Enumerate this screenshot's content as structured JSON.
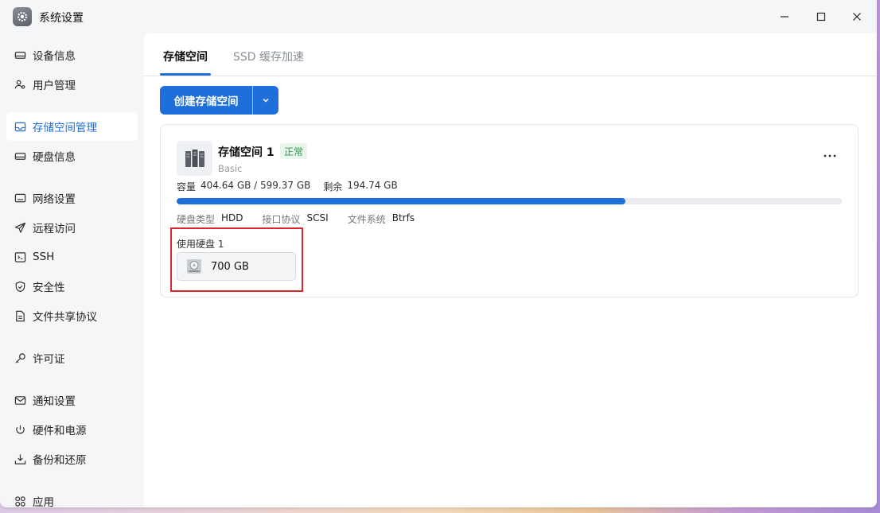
{
  "window": {
    "title": "系统设置"
  },
  "sidebar": {
    "items": [
      {
        "label": "设备信息",
        "icon": "hard-drive-icon"
      },
      {
        "label": "用户管理",
        "icon": "users-icon"
      },
      {
        "label": "存储空间管理",
        "icon": "inbox-icon",
        "active": true
      },
      {
        "label": "硬盘信息",
        "icon": "disk-icon"
      },
      {
        "label": "网络设置",
        "icon": "monitor-icon"
      },
      {
        "label": "远程访问",
        "icon": "send-icon"
      },
      {
        "label": "SSH",
        "icon": "terminal-icon"
      },
      {
        "label": "安全性",
        "icon": "shield-icon"
      },
      {
        "label": "文件共享协议",
        "icon": "file-icon"
      },
      {
        "label": "许可证",
        "icon": "key-icon"
      },
      {
        "label": "通知设置",
        "icon": "mail-icon"
      },
      {
        "label": "硬件和电源",
        "icon": "power-icon"
      },
      {
        "label": "备份和还原",
        "icon": "backup-icon"
      },
      {
        "label": "应用",
        "icon": "apps-icon"
      }
    ]
  },
  "tabs": [
    {
      "label": "存储空间",
      "active": true
    },
    {
      "label": "SSD 缓存加速",
      "active": false
    }
  ],
  "toolbar": {
    "create_label": "创建存储空间"
  },
  "pool": {
    "name": "存储空间 1",
    "status": "正常",
    "raid": "Basic",
    "capacity_label": "容量",
    "capacity_value": "404.64 GB / 599.37 GB",
    "free_label": "剩余",
    "free_value": "194.74 GB",
    "used_fraction": 0.675,
    "disk_type_label": "硬盘类型",
    "disk_type": "HDD",
    "interface_label": "接口协议",
    "interface": "SCSI",
    "fs_label": "文件系统",
    "fs": "Btrfs",
    "disks_label": "使用硬盘 1",
    "disks": [
      {
        "size": "700 GB"
      }
    ]
  },
  "colors": {
    "accent": "#1f6fdb",
    "ok": "#2e9a4f",
    "highlight": "#d9262c"
  }
}
